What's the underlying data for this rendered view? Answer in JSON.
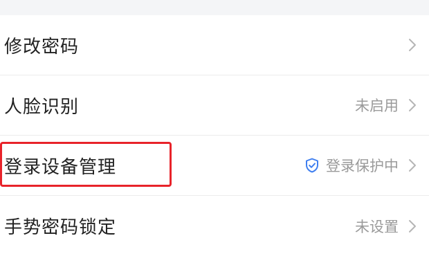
{
  "settings": {
    "items": [
      {
        "label": "修改密码",
        "value": "",
        "icon": ""
      },
      {
        "label": "人脸识别",
        "value": "未启用",
        "icon": ""
      },
      {
        "label": "登录设备管理",
        "value": "登录保护中",
        "icon": "shield-check-icon"
      },
      {
        "label": "手势密码锁定",
        "value": "未设置",
        "icon": ""
      }
    ]
  },
  "colors": {
    "label_text": "#222222",
    "value_text": "#9a9a9a",
    "chevron": "#b5b5b5",
    "shield": "#3f7ff0",
    "highlight": "#e8232a",
    "top_strip": "#f4f5f7",
    "divider": "#ececec"
  }
}
